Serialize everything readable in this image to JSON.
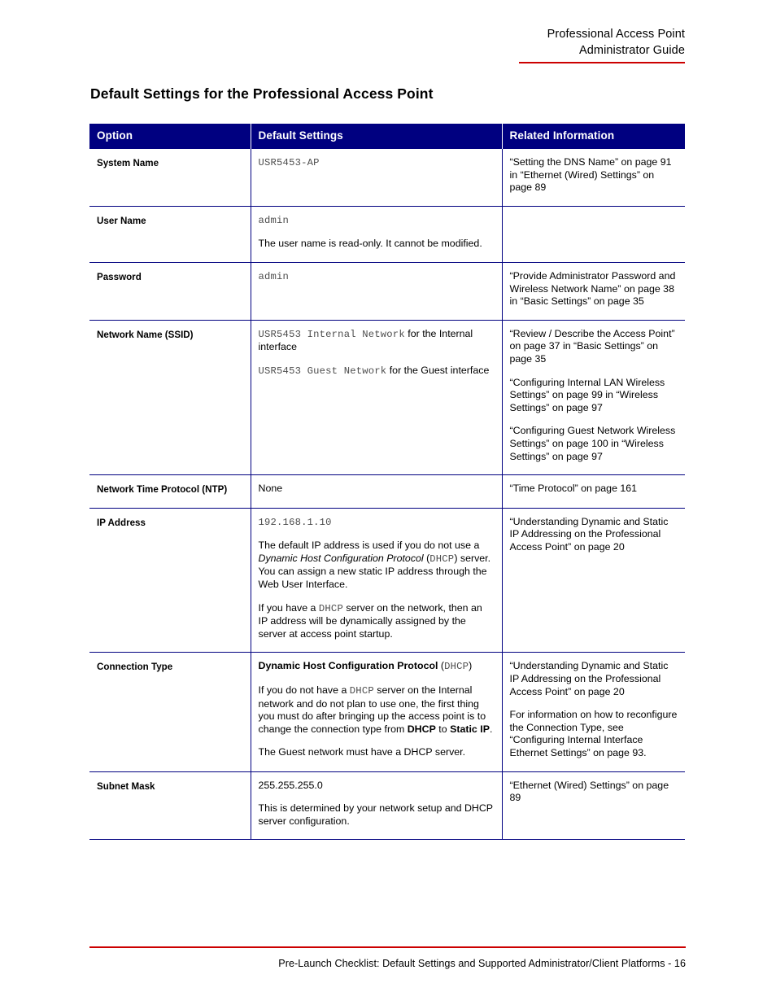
{
  "header": {
    "line1": "Professional Access Point",
    "line2": "Administrator Guide",
    "rule_color": "#cc0000"
  },
  "section": {
    "title": "Default Settings for the Professional Access Point"
  },
  "table": {
    "header_bg": "#000080",
    "header_text_color": "#ffffff",
    "border_color": "#000080",
    "columns": [
      "Option",
      "Default Settings",
      "Related Information"
    ],
    "rows": [
      {
        "option": "System Name",
        "default": {
          "p1_mono": "USR5453-AP"
        },
        "related": {
          "p1": "“Setting the DNS Name” on page 91 in “Ethernet (Wired) Settings” on page 89"
        }
      },
      {
        "option": "User Name",
        "default": {
          "p1_mono": "admin",
          "p2": "The user name is read-only. It cannot be modified."
        },
        "related": {
          "p1": ""
        }
      },
      {
        "option": "Password",
        "default": {
          "p1_mono": "admin"
        },
        "related": {
          "p1": "“Provide Administrator Password and Wireless Network Name” on page 38 in “Basic Settings” on page 35"
        }
      },
      {
        "option": "Network Name (SSID)",
        "default": {
          "p1_mono": "USR5453 Internal Network",
          "p1_rest": " for the Internal interface",
          "p2_mono": "USR5453 Guest Network",
          "p2_rest": " for the Guest interface"
        },
        "related": {
          "p1": "“Review / Describe the Access Point” on page 37 in “Basic Settings” on page 35",
          "p2": "“Configuring Internal LAN Wireless Settings” on page 99 in “Wireless Settings” on page 97",
          "p3": "“Configuring Guest Network Wireless Settings” on page 100 in “Wireless Settings” on page 97"
        }
      },
      {
        "option": "Network Time Protocol (NTP)",
        "default": {
          "p1": "None"
        },
        "related": {
          "p1": "“Time Protocol” on page 161"
        }
      },
      {
        "option": "IP Address",
        "default": {
          "p1_mono": "192.168.1.10",
          "p2_a": "The default IP address is used if you do not use a ",
          "p2_italic": "Dynamic Host Configuration Protocol",
          "p2_b": " (",
          "p2_mono": "DHCP",
          "p2_c": ") server. You can assign a new static IP address through the Web User Interface.",
          "p3_a": "If you have a ",
          "p3_mono": "DHCP",
          "p3_b": " server on the network, then an IP address will be dynamically assigned by the server at access point startup."
        },
        "related": {
          "p1": "“Understanding Dynamic and Static IP Addressing on the Professional Access Point” on page 20"
        }
      },
      {
        "option": "Connection Type",
        "default": {
          "p1_bold": "Dynamic Host Configuration Protocol",
          "p1_a": " (",
          "p1_mono": "DHCP",
          "p1_b": ")",
          "p2_a": "If you do not have a ",
          "p2_mono": "DHCP",
          "p2_b": " server on the Internal network and do not plan to use one, the first thing you must do after bringing up the access point is to change the connection type from ",
          "p2_bold1": "DHCP",
          "p2_c": " to ",
          "p2_bold2": "Static IP",
          "p2_d": ".",
          "p3": "The Guest network must have a DHCP server."
        },
        "related": {
          "p1": "“Understanding Dynamic and Static IP Addressing on the Professional Access Point” on page 20",
          "p2": "For information on how to reconfigure the Connection Type, see “Configuring Internal Interface Ethernet Settings” on page 93."
        }
      },
      {
        "option": "Subnet Mask",
        "default": {
          "p1": "255.255.255.0",
          "p2": "This is determined by your network setup and DHCP server configuration."
        },
        "related": {
          "p1": "“Ethernet (Wired) Settings” on page 89"
        }
      }
    ]
  },
  "footer": {
    "text": "Pre-Launch Checklist: Default Settings and Supported Administrator/Client Platforms - 16",
    "rule_color": "#cc0000"
  }
}
